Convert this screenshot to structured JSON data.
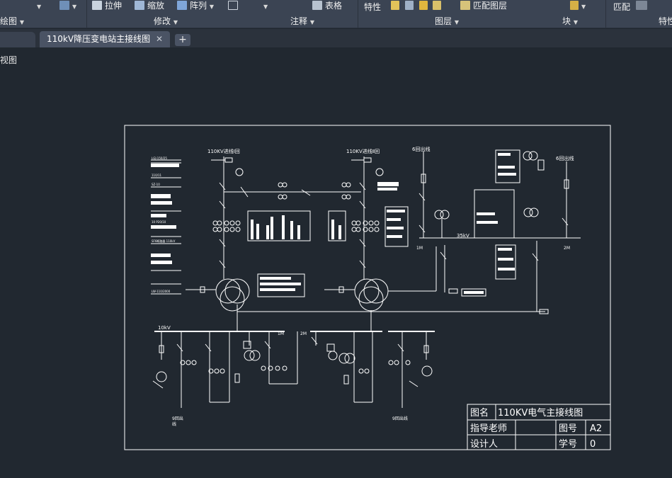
{
  "ribbon": {
    "draw_panel": "绘图",
    "modify_panel": "修改",
    "annotation_panel": "注释",
    "layers_panel": "图层",
    "block_panel": "块",
    "properties_panel": "特性",
    "stretch": "拉伸",
    "scale": "缩放",
    "array": "阵列",
    "table": "表格",
    "properties": "特性",
    "match_layer": "匹配图层",
    "match": "匹配"
  },
  "tabs": {
    "active": "110kV降压变电站主接线图",
    "close_symbol": "✕",
    "add_symbol": "+"
  },
  "viewport": {
    "label": "俯视图"
  },
  "drawing": {
    "labels": {
      "line1": "110KV进线Ⅰ回",
      "line2": "110KV进线Ⅱ回",
      "out6a": "6回出线",
      "out6b": "6回出线",
      "bus35": "35kV",
      "bus1m_right": "1M",
      "bus2m_right": "2M",
      "bus10": "10kV",
      "bus1m_low": "1M",
      "bus2m_low": "2M",
      "out9a": "9回出",
      "out9a2": "线",
      "out9b": "9回出线"
    },
    "spec_text": [
      "LGJ-150/25",
      "110/11",
      "SZ-10",
      "10 P20/10",
      "SF6断路器 110kV",
      "LW-110/2000"
    ],
    "title_block": {
      "name_label": "图名",
      "name_value": "110KV电气主接线图",
      "teacher_label": "指导老师",
      "number_label": "图号",
      "number_value": "A2",
      "designer_label": "设计人",
      "student_label": "学号",
      "student_value": "0"
    }
  },
  "colors": {
    "ribbon_bg": "#3b4453",
    "canvas_bg": "#212830",
    "line": "#ffffff"
  }
}
